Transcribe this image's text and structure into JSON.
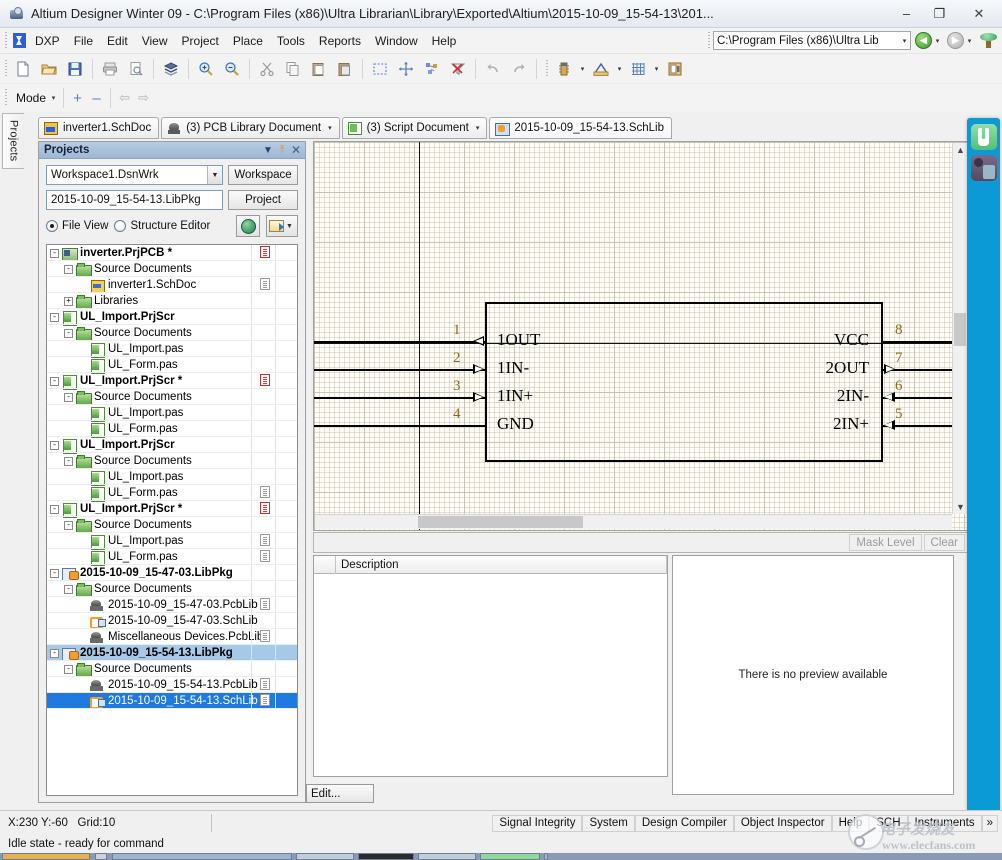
{
  "window": {
    "title": "Altium Designer Winter 09 - C:\\Program Files (x86)\\Ultra Librarian\\Library\\Exported\\Altium\\2015-10-09_15-54-13\\201...",
    "minimize": "–",
    "maximize": "❐",
    "close": "✕"
  },
  "menu": {
    "dxp": "DXP",
    "items": [
      "File",
      "Edit",
      "View",
      "Project",
      "Place",
      "Tools",
      "Reports",
      "Window",
      "Help"
    ],
    "path_value": "C:\\Program Files (x86)\\Ultra Lib",
    "caret": "▾"
  },
  "mode_toolbar": {
    "label": "Mode",
    "caret": "▾",
    "plus": "+",
    "minus": "–",
    "prev": "⇦",
    "next": "⇨"
  },
  "vertical_tab": {
    "label": "Projects"
  },
  "doc_tabs": [
    {
      "label": "inverter1.SchDoc",
      "icon": "schdoc-icon",
      "type": "sch",
      "caret": "",
      "active": false
    },
    {
      "label": "(3) PCB Library Document",
      "icon": "pcblib-icon",
      "type": "pcb",
      "caret": "▾",
      "active": false
    },
    {
      "label": "(3) Script Document",
      "icon": "script-icon",
      "type": "scr",
      "caret": "▾",
      "active": false
    },
    {
      "label": "2015-10-09_15-54-13.SchLib",
      "icon": "schlib-icon",
      "type": "lib",
      "caret": "",
      "active": true
    }
  ],
  "projects_panel": {
    "title": "Projects",
    "header_icons": {
      "dropdown": "▼",
      "pin": "⤒",
      "close": "✕"
    },
    "workspace_combo": "Workspace1.DsnWrk",
    "workspace_button": "Workspace",
    "project_textbox": "2015-10-09_15-54-13.LibPkg",
    "project_button": "Project",
    "view_modes": [
      {
        "label": "File View",
        "selected": true
      },
      {
        "label": "Structure Editor",
        "selected": false
      }
    ],
    "tree": [
      {
        "indent": 0,
        "expander": "-",
        "icon": "prjpcb",
        "label": "inverter.PrjPCB *",
        "bold": true,
        "flag": "red"
      },
      {
        "indent": 1,
        "expander": "-",
        "icon": "folder",
        "label": "Source Documents",
        "bold": false,
        "flag": ""
      },
      {
        "indent": 2,
        "expander": "",
        "icon": "sch",
        "label": "inverter1.SchDoc",
        "bold": false,
        "flag": "gray"
      },
      {
        "indent": 1,
        "expander": "+",
        "icon": "folder",
        "label": "Libraries",
        "bold": false,
        "flag": ""
      },
      {
        "indent": 0,
        "expander": "-",
        "icon": "prjscr",
        "label": "UL_Import.PrjScr",
        "bold": true,
        "flag": ""
      },
      {
        "indent": 1,
        "expander": "-",
        "icon": "folder",
        "label": "Source Documents",
        "bold": false,
        "flag": ""
      },
      {
        "indent": 2,
        "expander": "",
        "icon": "pas",
        "label": "UL_Import.pas",
        "bold": false,
        "flag": ""
      },
      {
        "indent": 2,
        "expander": "",
        "icon": "pas",
        "label": "UL_Form.pas",
        "bold": false,
        "flag": ""
      },
      {
        "indent": 0,
        "expander": "-",
        "icon": "prjscr",
        "label": "UL_Import.PrjScr *",
        "bold": true,
        "flag": "red"
      },
      {
        "indent": 1,
        "expander": "-",
        "icon": "folder",
        "label": "Source Documents",
        "bold": false,
        "flag": ""
      },
      {
        "indent": 2,
        "expander": "",
        "icon": "pas",
        "label": "UL_Import.pas",
        "bold": false,
        "flag": ""
      },
      {
        "indent": 2,
        "expander": "",
        "icon": "pas",
        "label": "UL_Form.pas",
        "bold": false,
        "flag": ""
      },
      {
        "indent": 0,
        "expander": "-",
        "icon": "prjscr",
        "label": "UL_Import.PrjScr",
        "bold": true,
        "flag": ""
      },
      {
        "indent": 1,
        "expander": "-",
        "icon": "folder",
        "label": "Source Documents",
        "bold": false,
        "flag": ""
      },
      {
        "indent": 2,
        "expander": "",
        "icon": "pas",
        "label": "UL_Import.pas",
        "bold": false,
        "flag": ""
      },
      {
        "indent": 2,
        "expander": "",
        "icon": "pas",
        "label": "UL_Form.pas",
        "bold": false,
        "flag": "gray"
      },
      {
        "indent": 0,
        "expander": "-",
        "icon": "prjscr",
        "label": "UL_Import.PrjScr *",
        "bold": true,
        "flag": "red"
      },
      {
        "indent": 1,
        "expander": "-",
        "icon": "folder",
        "label": "Source Documents",
        "bold": false,
        "flag": ""
      },
      {
        "indent": 2,
        "expander": "",
        "icon": "pas",
        "label": "UL_Import.pas",
        "bold": false,
        "flag": "gray"
      },
      {
        "indent": 2,
        "expander": "",
        "icon": "pas",
        "label": "UL_Form.pas",
        "bold": false,
        "flag": "gray"
      },
      {
        "indent": 0,
        "expander": "-",
        "icon": "libpkg",
        "label": "2015-10-09_15-47-03.LibPkg",
        "bold": true,
        "flag": ""
      },
      {
        "indent": 1,
        "expander": "-",
        "icon": "folder",
        "label": "Source Documents",
        "bold": false,
        "flag": ""
      },
      {
        "indent": 2,
        "expander": "",
        "icon": "pcblib",
        "label": "2015-10-09_15-47-03.PcbLib",
        "bold": false,
        "flag": "gray"
      },
      {
        "indent": 2,
        "expander": "",
        "icon": "schlib",
        "label": "2015-10-09_15-47-03.SchLib",
        "bold": false,
        "flag": ""
      },
      {
        "indent": 2,
        "expander": "",
        "icon": "pcblib",
        "label": "Miscellaneous Devices.PcbLib",
        "bold": false,
        "flag": "gray"
      },
      {
        "indent": 0,
        "expander": "-",
        "icon": "libpkg",
        "label": "2015-10-09_15-54-13.LibPkg",
        "bold": true,
        "flag": "",
        "state": "sel"
      },
      {
        "indent": 1,
        "expander": "-",
        "icon": "folder",
        "label": "Source Documents",
        "bold": false,
        "flag": ""
      },
      {
        "indent": 2,
        "expander": "",
        "icon": "pcblib",
        "label": "2015-10-09_15-54-13.PcbLib",
        "bold": false,
        "flag": "gray"
      },
      {
        "indent": 2,
        "expander": "",
        "icon": "schlib",
        "label": "2015-10-09_15-54-13.SchLib",
        "bold": false,
        "flag": "gray",
        "state": "sel2"
      }
    ]
  },
  "canvas": {
    "symbol": {
      "left_pins": [
        {
          "number": "1",
          "name": "1OUT",
          "arrow": "out"
        },
        {
          "number": "2",
          "name": "1IN-",
          "arrow": "in"
        },
        {
          "number": "3",
          "name": "1IN+",
          "arrow": "in"
        },
        {
          "number": "4",
          "name": "GND",
          "arrow": "none"
        }
      ],
      "right_pins": [
        {
          "number": "8",
          "name": "VCC",
          "arrow": "none"
        },
        {
          "number": "7",
          "name": "2OUT",
          "arrow": "out"
        },
        {
          "number": "6",
          "name": "2IN-",
          "arrow": "in"
        },
        {
          "number": "5",
          "name": "2IN+",
          "arrow": "in"
        }
      ]
    }
  },
  "mask_bar": {
    "mask_level": "Mask Level",
    "clear": "Clear"
  },
  "lower": {
    "list_header": [
      "",
      "Description"
    ],
    "preview_text": "There is no preview available",
    "edit_button": "Edit...",
    "collapse": "›"
  },
  "status": {
    "coords": "X:230 Y:-60",
    "grid": "Grid:10",
    "buttons": [
      "Signal Integrity",
      "System",
      "Design Compiler",
      "Object Inspector",
      "Help",
      "SCH",
      "Instruments"
    ],
    "idle": "Idle state - ready for command"
  },
  "watermark": {
    "cn": "电子发烧友",
    "url": "www.elecfans.com"
  }
}
